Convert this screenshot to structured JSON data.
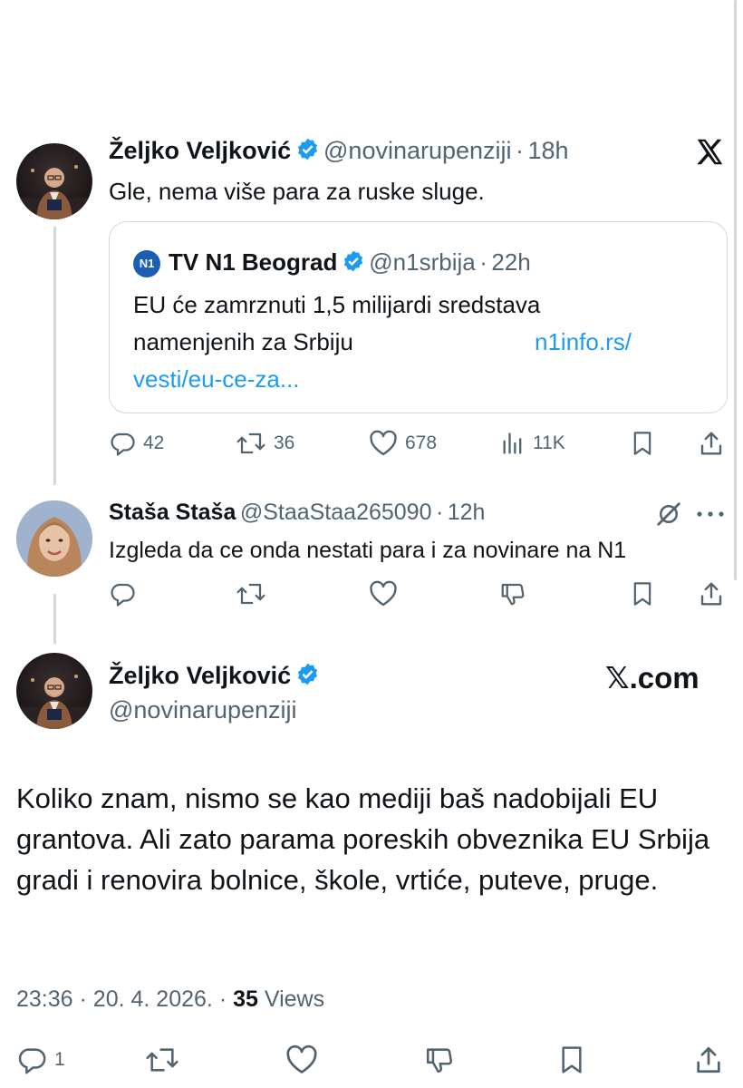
{
  "tweet1": {
    "name": "Željko Veljković",
    "handle": "@novinarupenziji",
    "sep": "·",
    "time": "18h",
    "text": "Gle, nema više para za ruske sluge.",
    "brand_icon": "x-logo-icon",
    "quote": {
      "name": "TV N1 Beograd",
      "logo_text": "N1",
      "handle": "@n1srbija",
      "sep": "·",
      "time": "22h",
      "line1": "EU će zamrznuti 1,5 milijardi sredstava",
      "line2": "namenjenih za Srbiju",
      "link_part1": "n1info.rs/",
      "link_part2": "vesti/eu-ce-za..."
    },
    "actions": {
      "replies": "42",
      "reposts": "36",
      "likes": "678",
      "views": "11K"
    }
  },
  "reply": {
    "name": "Staša Staša",
    "handle": "@StaaStaa265090",
    "sep": "·",
    "time": "12h",
    "text": "Izgleda da ce onda nestati para i za novinare na N1"
  },
  "main": {
    "name": "Željko Veljković",
    "handle": "@novinarupenziji",
    "brand": "𝕏.com",
    "text": "Koliko znam, nismo se kao mediji baš nadobijali EU grantova. Ali zato parama poreskih obveznika EU Srbija gradi i renovira bolnice, škole, vrtiće, puteve, pruge.",
    "time": "23:36",
    "date": "20. 4. 2026.",
    "sep": "·",
    "views_count": "35",
    "views_label": "Views",
    "replies": "1"
  },
  "colors": {
    "accent": "#1d9bf0",
    "text": "#0f1419",
    "muted": "#536471",
    "border": "#cfd9de"
  }
}
